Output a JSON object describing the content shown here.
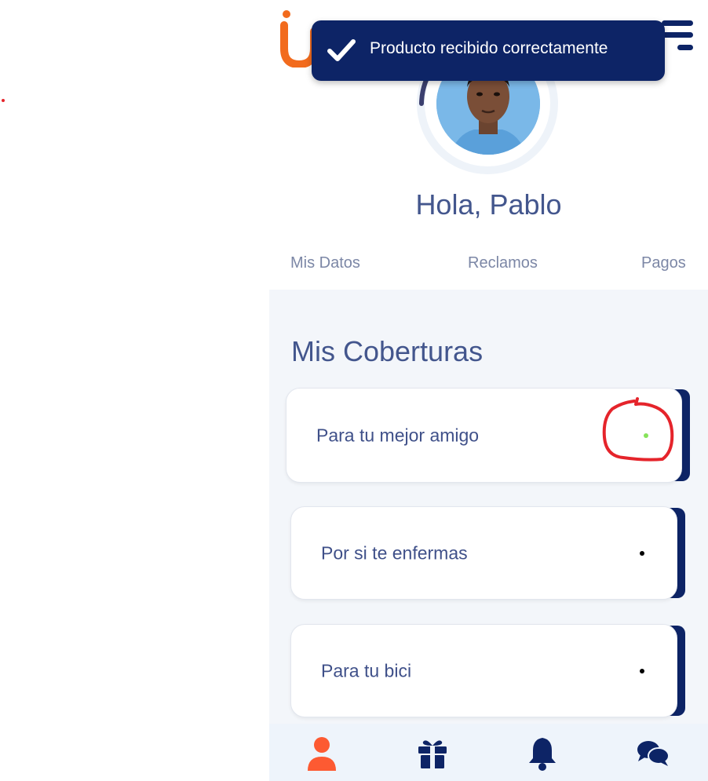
{
  "toast": {
    "message": "Producto recibido correctamente",
    "icon": "check-icon"
  },
  "header": {
    "logo": "logo-icon",
    "menu": "menu-icon"
  },
  "profile": {
    "greeting": "Hola, Pablo"
  },
  "tabs": [
    {
      "label": "Mis Datos"
    },
    {
      "label": "Reclamos"
    },
    {
      "label": "Pagos"
    }
  ],
  "coverages": {
    "title": "Mis Coberturas",
    "items": [
      {
        "label": "Para tu mejor amigo",
        "indicator_color": "#86e35a"
      },
      {
        "label": "Por si te enfermas",
        "indicator_color": "#000000"
      },
      {
        "label": "Para tu bici",
        "indicator_color": "#000000"
      }
    ]
  },
  "bottom_nav": [
    {
      "icon": "user-icon",
      "active": true
    },
    {
      "icon": "gift-icon",
      "active": false
    },
    {
      "icon": "bell-icon",
      "active": false
    },
    {
      "icon": "chat-icon",
      "active": false
    }
  ],
  "colors": {
    "primary": "#0d2466",
    "accent": "#fd5a32",
    "text": "#43568d",
    "annotation": "#e5242b"
  }
}
